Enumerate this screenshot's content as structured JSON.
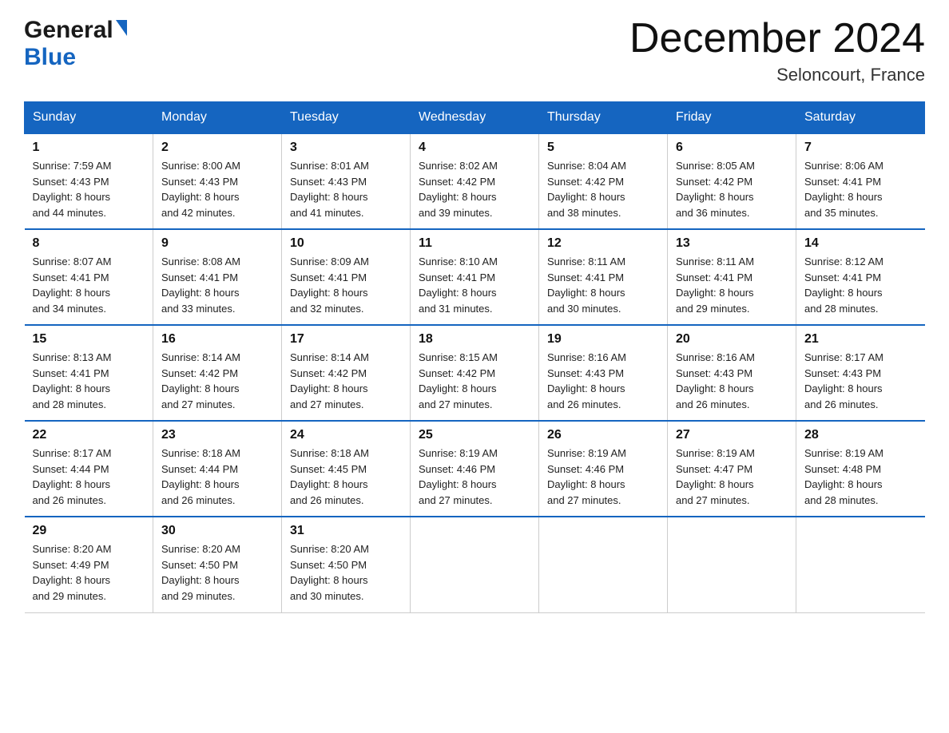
{
  "header": {
    "month_title": "December 2024",
    "location": "Seloncourt, France",
    "logo_line1": "General",
    "logo_line2": "Blue"
  },
  "days_of_week": [
    "Sunday",
    "Monday",
    "Tuesday",
    "Wednesday",
    "Thursday",
    "Friday",
    "Saturday"
  ],
  "weeks": [
    [
      {
        "day": "1",
        "sunrise": "7:59 AM",
        "sunset": "4:43 PM",
        "daylight": "8 hours and 44 minutes."
      },
      {
        "day": "2",
        "sunrise": "8:00 AM",
        "sunset": "4:43 PM",
        "daylight": "8 hours and 42 minutes."
      },
      {
        "day": "3",
        "sunrise": "8:01 AM",
        "sunset": "4:43 PM",
        "daylight": "8 hours and 41 minutes."
      },
      {
        "day": "4",
        "sunrise": "8:02 AM",
        "sunset": "4:42 PM",
        "daylight": "8 hours and 39 minutes."
      },
      {
        "day": "5",
        "sunrise": "8:04 AM",
        "sunset": "4:42 PM",
        "daylight": "8 hours and 38 minutes."
      },
      {
        "day": "6",
        "sunrise": "8:05 AM",
        "sunset": "4:42 PM",
        "daylight": "8 hours and 36 minutes."
      },
      {
        "day": "7",
        "sunrise": "8:06 AM",
        "sunset": "4:41 PM",
        "daylight": "8 hours and 35 minutes."
      }
    ],
    [
      {
        "day": "8",
        "sunrise": "8:07 AM",
        "sunset": "4:41 PM",
        "daylight": "8 hours and 34 minutes."
      },
      {
        "day": "9",
        "sunrise": "8:08 AM",
        "sunset": "4:41 PM",
        "daylight": "8 hours and 33 minutes."
      },
      {
        "day": "10",
        "sunrise": "8:09 AM",
        "sunset": "4:41 PM",
        "daylight": "8 hours and 32 minutes."
      },
      {
        "day": "11",
        "sunrise": "8:10 AM",
        "sunset": "4:41 PM",
        "daylight": "8 hours and 31 minutes."
      },
      {
        "day": "12",
        "sunrise": "8:11 AM",
        "sunset": "4:41 PM",
        "daylight": "8 hours and 30 minutes."
      },
      {
        "day": "13",
        "sunrise": "8:11 AM",
        "sunset": "4:41 PM",
        "daylight": "8 hours and 29 minutes."
      },
      {
        "day": "14",
        "sunrise": "8:12 AM",
        "sunset": "4:41 PM",
        "daylight": "8 hours and 28 minutes."
      }
    ],
    [
      {
        "day": "15",
        "sunrise": "8:13 AM",
        "sunset": "4:41 PM",
        "daylight": "8 hours and 28 minutes."
      },
      {
        "day": "16",
        "sunrise": "8:14 AM",
        "sunset": "4:42 PM",
        "daylight": "8 hours and 27 minutes."
      },
      {
        "day": "17",
        "sunrise": "8:14 AM",
        "sunset": "4:42 PM",
        "daylight": "8 hours and 27 minutes."
      },
      {
        "day": "18",
        "sunrise": "8:15 AM",
        "sunset": "4:42 PM",
        "daylight": "8 hours and 27 minutes."
      },
      {
        "day": "19",
        "sunrise": "8:16 AM",
        "sunset": "4:43 PM",
        "daylight": "8 hours and 26 minutes."
      },
      {
        "day": "20",
        "sunrise": "8:16 AM",
        "sunset": "4:43 PM",
        "daylight": "8 hours and 26 minutes."
      },
      {
        "day": "21",
        "sunrise": "8:17 AM",
        "sunset": "4:43 PM",
        "daylight": "8 hours and 26 minutes."
      }
    ],
    [
      {
        "day": "22",
        "sunrise": "8:17 AM",
        "sunset": "4:44 PM",
        "daylight": "8 hours and 26 minutes."
      },
      {
        "day": "23",
        "sunrise": "8:18 AM",
        "sunset": "4:44 PM",
        "daylight": "8 hours and 26 minutes."
      },
      {
        "day": "24",
        "sunrise": "8:18 AM",
        "sunset": "4:45 PM",
        "daylight": "8 hours and 26 minutes."
      },
      {
        "day": "25",
        "sunrise": "8:19 AM",
        "sunset": "4:46 PM",
        "daylight": "8 hours and 27 minutes."
      },
      {
        "day": "26",
        "sunrise": "8:19 AM",
        "sunset": "4:46 PM",
        "daylight": "8 hours and 27 minutes."
      },
      {
        "day": "27",
        "sunrise": "8:19 AM",
        "sunset": "4:47 PM",
        "daylight": "8 hours and 27 minutes."
      },
      {
        "day": "28",
        "sunrise": "8:19 AM",
        "sunset": "4:48 PM",
        "daylight": "8 hours and 28 minutes."
      }
    ],
    [
      {
        "day": "29",
        "sunrise": "8:20 AM",
        "sunset": "4:49 PM",
        "daylight": "8 hours and 29 minutes."
      },
      {
        "day": "30",
        "sunrise": "8:20 AM",
        "sunset": "4:50 PM",
        "daylight": "8 hours and 29 minutes."
      },
      {
        "day": "31",
        "sunrise": "8:20 AM",
        "sunset": "4:50 PM",
        "daylight": "8 hours and 30 minutes."
      },
      null,
      null,
      null,
      null
    ]
  ],
  "labels": {
    "sunrise": "Sunrise:",
    "sunset": "Sunset:",
    "daylight": "Daylight:"
  }
}
